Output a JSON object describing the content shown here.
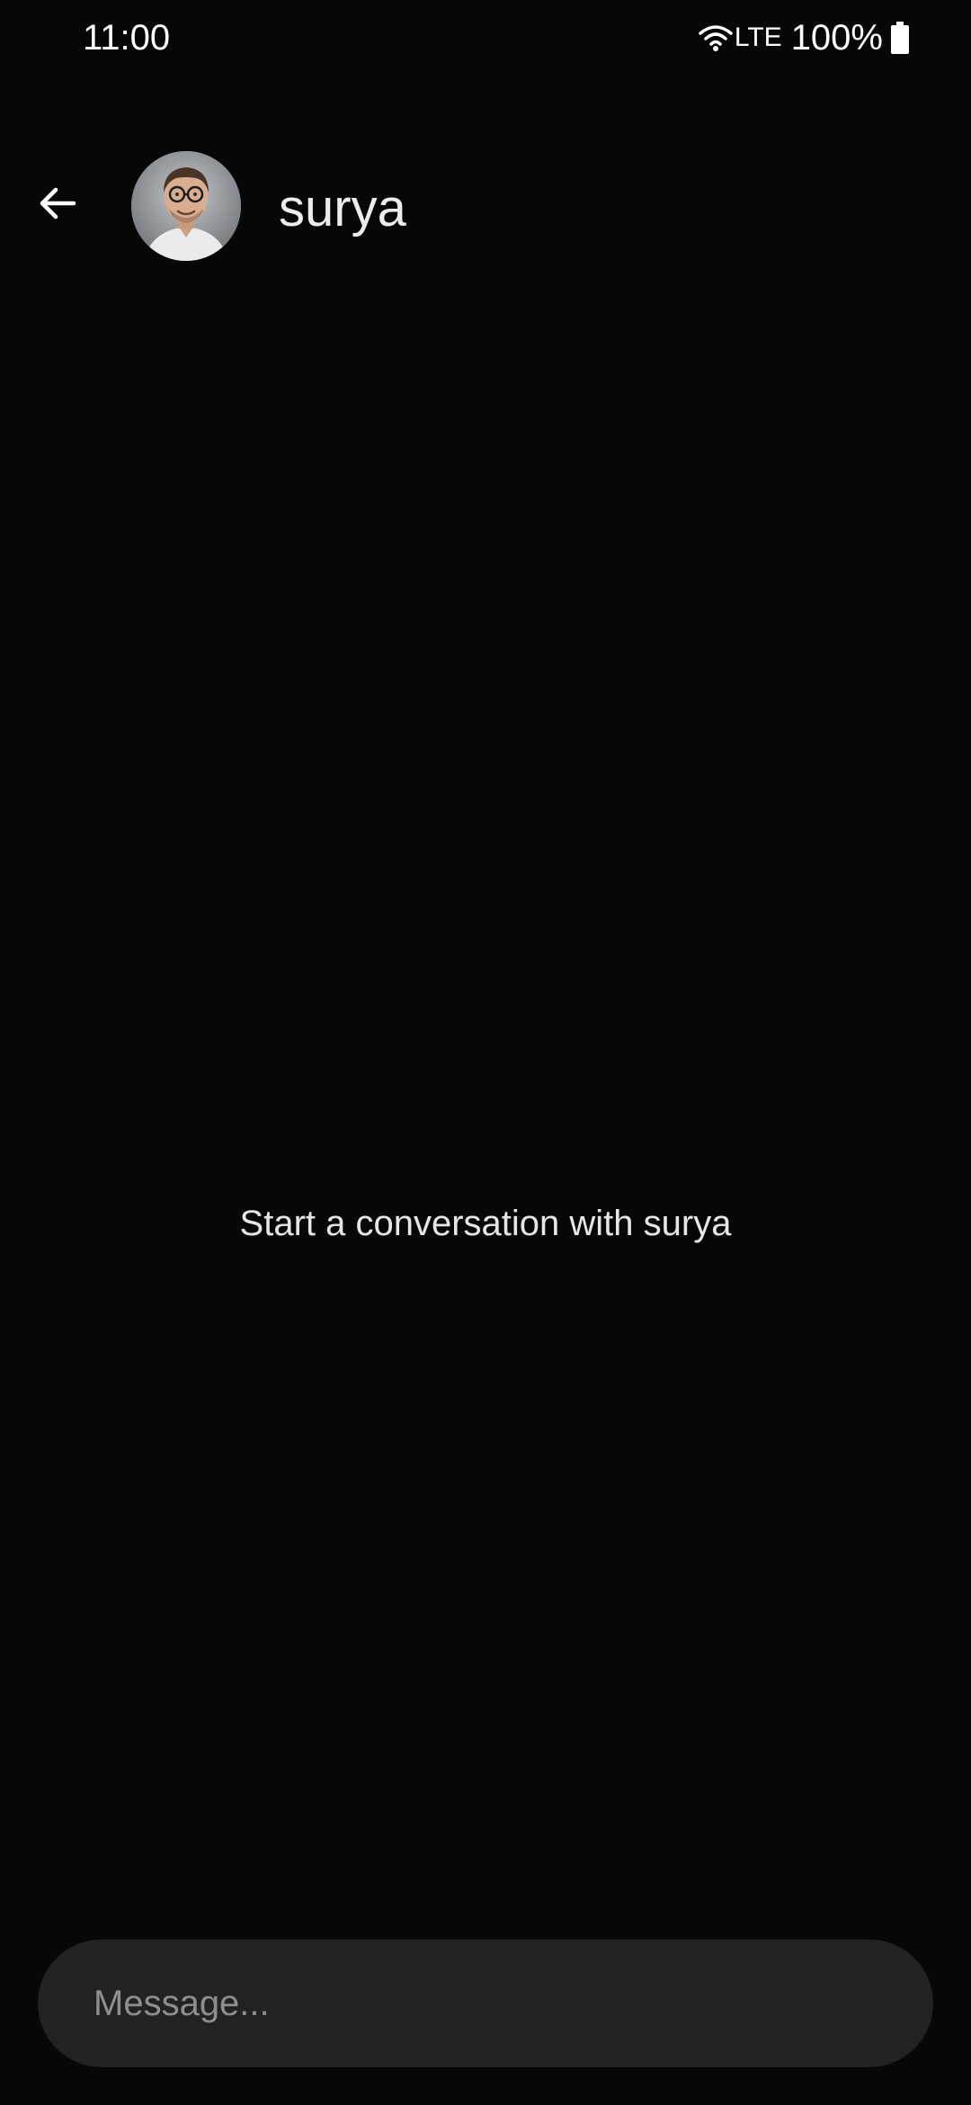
{
  "status_bar": {
    "time": "11:00",
    "network": "LTE",
    "battery": "100%",
    "icons": [
      "wifi-icon",
      "battery-icon"
    ]
  },
  "header": {
    "back_icon": "arrow-left-icon",
    "contact_name": "surya"
  },
  "conversation": {
    "empty_text": "Start a conversation with surya"
  },
  "composer": {
    "placeholder": "Message..."
  },
  "colors": {
    "background": "#070707",
    "composer": "#222222",
    "text": "#ffffff",
    "placeholder": "#8e8e8e"
  }
}
